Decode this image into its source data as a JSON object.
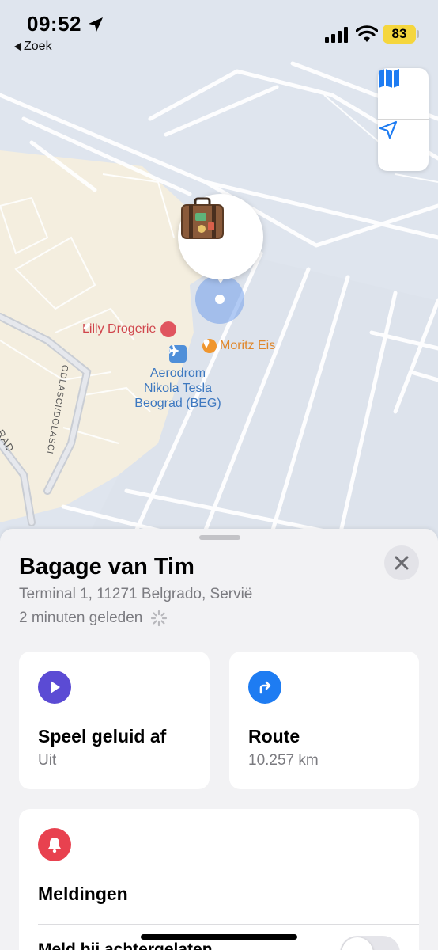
{
  "status_bar": {
    "time": "09:52",
    "back_label": "Zoek",
    "battery": "83",
    "battery_color": "#f5d63d"
  },
  "map": {
    "poi_lilly": "Lilly Drogerie",
    "poi_moritz": "Moritz Eis",
    "airport_line1": "Aerodrom",
    "airport_line2": "Nikola Tesla",
    "airport_line3": "Beograd (BEG)",
    "road_odlasci": "ODLASCI/DOLASCI",
    "road_partial": "RAD",
    "controls": {
      "map_mode_icon": "map-icon",
      "locate_icon": "location-arrow-icon"
    },
    "pin_icon": "suitcase-icon",
    "accent": "#1e7cf2"
  },
  "sheet": {
    "title": "Bagage van Tim",
    "address": "Terminal 1, 11271 Belgrado, Servië",
    "updated": "2 minuten geleden",
    "sound_card": {
      "title": "Speel geluid af",
      "subtitle": "Uit",
      "icon_color": "#5b4bd4"
    },
    "route_card": {
      "title": "Route",
      "subtitle": "10.257 km",
      "icon_color": "#1e7cf2"
    },
    "notifications_card": {
      "title": "Meldingen",
      "row_label": "Meld bij achtergelaten",
      "icon_color": "#e8414f",
      "toggle_on": false
    }
  }
}
